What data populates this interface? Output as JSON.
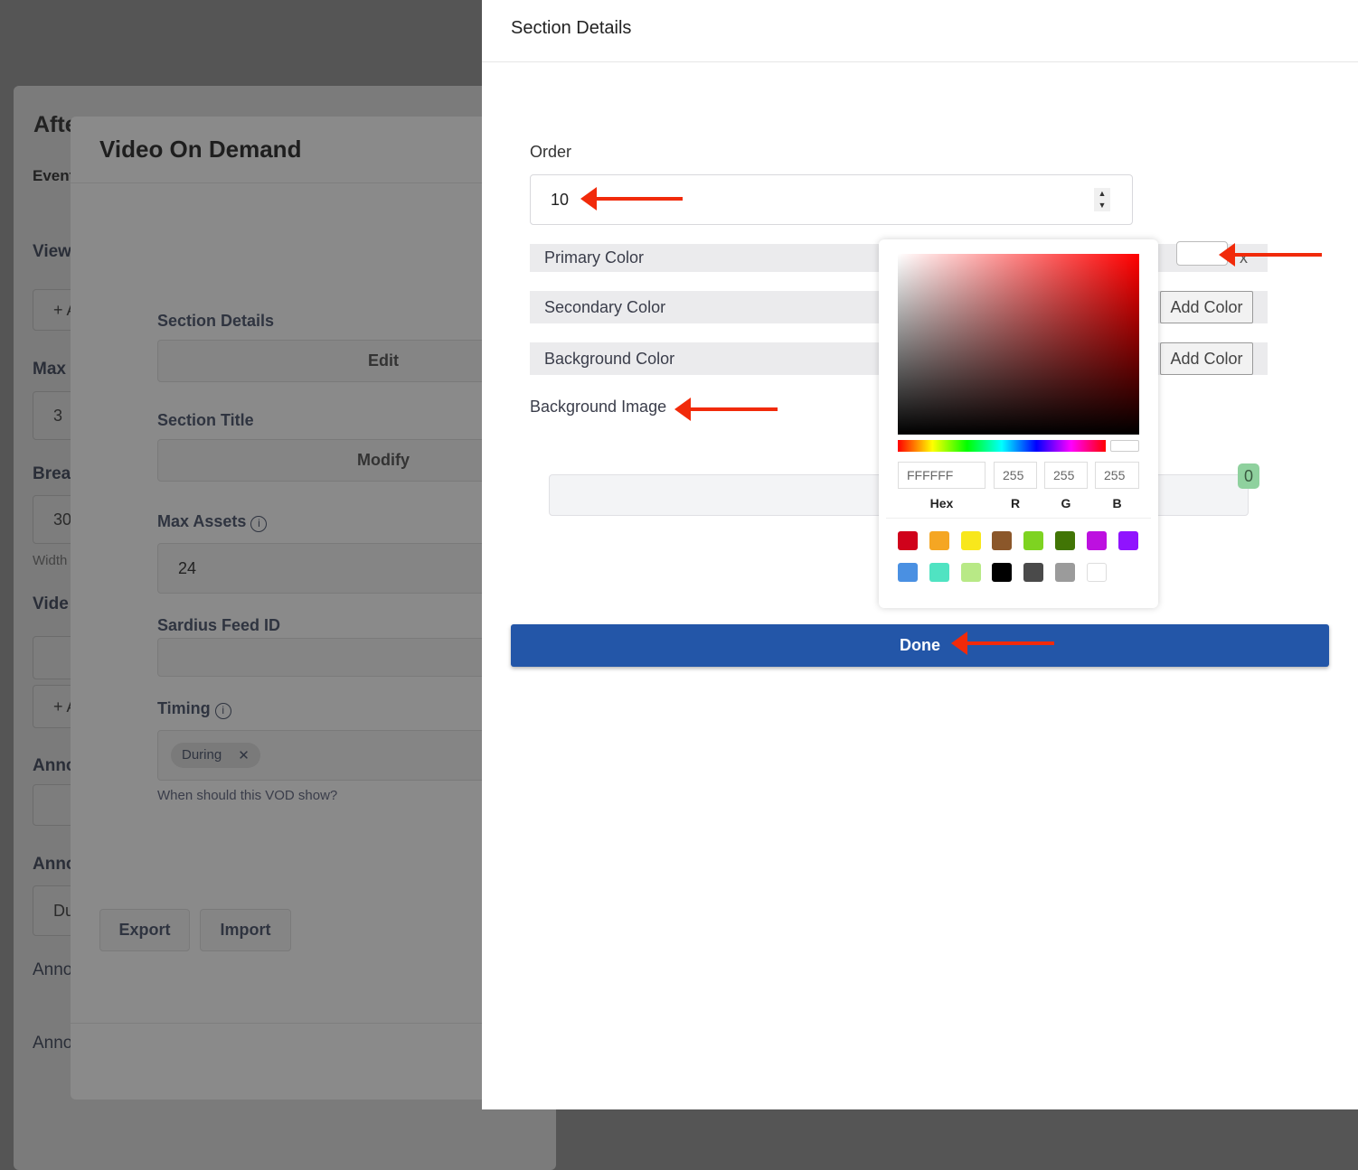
{
  "background_page": {
    "title": "Afte",
    "tab": "Event",
    "labels": [
      "View",
      "Max",
      "Brea",
      "Vide",
      "Anno",
      "Anno",
      "Anno",
      "Anno"
    ],
    "add_btn": "+ A",
    "max_value": "3",
    "break_value": "30",
    "width_hint": "Width",
    "chip": "Du"
  },
  "vod_modal": {
    "title": "Video On Demand",
    "section_details_label": "Section Details",
    "edit_button": "Edit",
    "section_title_label": "Section Title",
    "modify_button": "Modify",
    "max_assets_label": "Max Assets",
    "max_assets_value": "24",
    "sardius_label": "Sardius Feed ID",
    "sardius_value": "",
    "timing_label": "Timing",
    "timing_chip": "During",
    "timing_help": "When should this VOD show?",
    "export_button": "Export",
    "import_button": "Import"
  },
  "panel": {
    "title": "Section Details",
    "order_label": "Order",
    "order_value": "10",
    "primary_color_label": "Primary Color",
    "secondary_color_label": "Secondary Color",
    "secondary_add": "Add Color",
    "background_color_label": "Background Color",
    "background_add": "Add Color",
    "background_image_label": "Background Image",
    "upload_count": "0",
    "done_button": "Done",
    "primary_close": "x"
  },
  "color_picker": {
    "hex": "FFFFFF",
    "r": "255",
    "g": "255",
    "b": "255",
    "hex_label": "Hex",
    "r_label": "R",
    "g_label": "G",
    "b_label": "B",
    "swatches": [
      "#D0021B",
      "#F5A623",
      "#F8E71C",
      "#8B572A",
      "#7ED321",
      "#417505",
      "#BD10E0",
      "#9013FE",
      "#4A90E2",
      "#50E3C2",
      "#B8E986",
      "#000000",
      "#4A4A4A",
      "#9B9B9B",
      "#FFFFFF"
    ]
  },
  "colors": {
    "accent": "#2356A8",
    "annotation_arrow": "#F12A0A"
  }
}
